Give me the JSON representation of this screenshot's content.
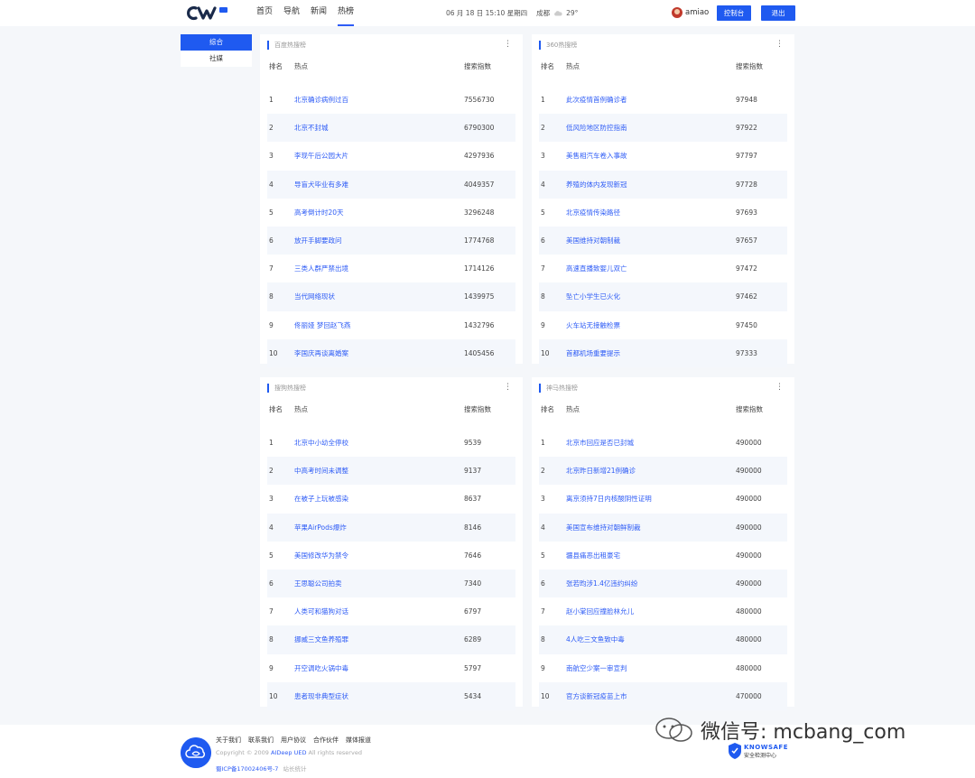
{
  "header": {
    "nav": [
      "首页",
      "导航",
      "新闻",
      "热榜"
    ],
    "active_nav": 3,
    "datetime": "06 月 18 日 15:10 星期四",
    "city": "成都",
    "temperature": "29°",
    "username": "amiao",
    "console_button": "控制台",
    "logout_button": "退出"
  },
  "sidebar": {
    "items": [
      "综合",
      "社媒"
    ],
    "active": 0
  },
  "columns": {
    "rank": "排名",
    "topic": "热点",
    "index": "搜索指数"
  },
  "boards": [
    {
      "title": "百度热搜榜",
      "rows": [
        {
          "rank": "1",
          "topic": "北京确诊病例过百",
          "value": "7556730"
        },
        {
          "rank": "2",
          "topic": "北京不封城",
          "value": "6790300"
        },
        {
          "rank": "3",
          "topic": "李现午后公园大片",
          "value": "4297936"
        },
        {
          "rank": "4",
          "topic": "导盲犬毕业有多难",
          "value": "4049357"
        },
        {
          "rank": "5",
          "topic": "高考倒计时20天",
          "value": "3296248"
        },
        {
          "rank": "6",
          "topic": "放开手脚要政问",
          "value": "1774768"
        },
        {
          "rank": "7",
          "topic": "三类人群严禁出境",
          "value": "1714126"
        },
        {
          "rank": "8",
          "topic": "当代网络现状",
          "value": "1439975"
        },
        {
          "rank": "9",
          "topic": "佟丽娅 梦回赵飞燕",
          "value": "1432796"
        },
        {
          "rank": "10",
          "topic": "李国庆再谈离婚案",
          "value": "1405456"
        }
      ]
    },
    {
      "title": "360热搜榜",
      "rows": [
        {
          "rank": "1",
          "topic": "此次疫情首例确诊者",
          "value": "97948"
        },
        {
          "rank": "2",
          "topic": "低风险地区防控指南",
          "value": "97922"
        },
        {
          "rank": "3",
          "topic": "美售相汽车卷入事故",
          "value": "97797"
        },
        {
          "rank": "4",
          "topic": "养殖的体内发现新冠",
          "value": "97728"
        },
        {
          "rank": "5",
          "topic": "北京疫情传染路径",
          "value": "97693"
        },
        {
          "rank": "6",
          "topic": "美国维持对朝制裁",
          "value": "97657"
        },
        {
          "rank": "7",
          "topic": "高速直播致婴儿双亡",
          "value": "97472"
        },
        {
          "rank": "8",
          "topic": "坠亡小学生已火化",
          "value": "97462"
        },
        {
          "rank": "9",
          "topic": "火车站无接触检票",
          "value": "97450"
        },
        {
          "rank": "10",
          "topic": "首都机场重要提示",
          "value": "97333"
        }
      ]
    },
    {
      "title": "搜狗热搜榜",
      "rows": [
        {
          "rank": "1",
          "topic": "北京中小幼全停校",
          "value": "9539"
        },
        {
          "rank": "2",
          "topic": "中高考时间未调整",
          "value": "9137"
        },
        {
          "rank": "3",
          "topic": "在被子上玩被感染",
          "value": "8637"
        },
        {
          "rank": "4",
          "topic": "苹果AirPods爆炸",
          "value": "8146"
        },
        {
          "rank": "5",
          "topic": "美国修改华为禁令",
          "value": "7646"
        },
        {
          "rank": "6",
          "topic": "王思聪公司拍卖",
          "value": "7340"
        },
        {
          "rank": "7",
          "topic": "人类可和猫狗对话",
          "value": "6797"
        },
        {
          "rank": "8",
          "topic": "挪威三文鱼养殖罪",
          "value": "6289"
        },
        {
          "rank": "9",
          "topic": "开空调吃火锅中毒",
          "value": "5797"
        },
        {
          "rank": "10",
          "topic": "患者现非典型症状",
          "value": "5434"
        }
      ]
    },
    {
      "title": "神马热搜榜",
      "rows": [
        {
          "rank": "1",
          "topic": "北京市回应是否已封城",
          "value": "490000"
        },
        {
          "rank": "2",
          "topic": "北京昨日新增21例确诊",
          "value": "490000"
        },
        {
          "rank": "3",
          "topic": "离京须持7日内核酸阴性证明",
          "value": "490000"
        },
        {
          "rank": "4",
          "topic": "美国宣布维持对朝鲜制裁",
          "value": "490000"
        },
        {
          "rank": "5",
          "topic": "疆县痛恶出租豪宅",
          "value": "490000"
        },
        {
          "rank": "6",
          "topic": "张若昀涉1.4亿违约纠纷",
          "value": "490000"
        },
        {
          "rank": "7",
          "topic": "赵小棠回应撞脸林允儿",
          "value": "480000"
        },
        {
          "rank": "8",
          "topic": "4人吃三文鱼致中毒",
          "value": "480000"
        },
        {
          "rank": "9",
          "topic": "南航空少案一审宣判",
          "value": "480000"
        },
        {
          "rank": "10",
          "topic": "官方谈新冠疫苗上市",
          "value": "470000"
        }
      ]
    }
  ],
  "footer": {
    "links": [
      "关于我们",
      "联系我们",
      "用户协议",
      "合作伙伴",
      "媒体报道"
    ],
    "copyright_prefix": "Copyright © 2009",
    "brand": "AIDeep UED",
    "copyright_suffix": "All rights reserved",
    "icp": "蜀ICP备17002406号-7",
    "stats": "站长统计",
    "watermark": "微信号: mcbang_com",
    "knowsafe_name": "KNOWSAFE",
    "knowsafe_sub": "安全检测中心"
  },
  "colors": {
    "accent": "#1f5af0",
    "link": "#2e5cf6",
    "row_alt": "#f4f7fc",
    "background": "#f5f7fa"
  }
}
